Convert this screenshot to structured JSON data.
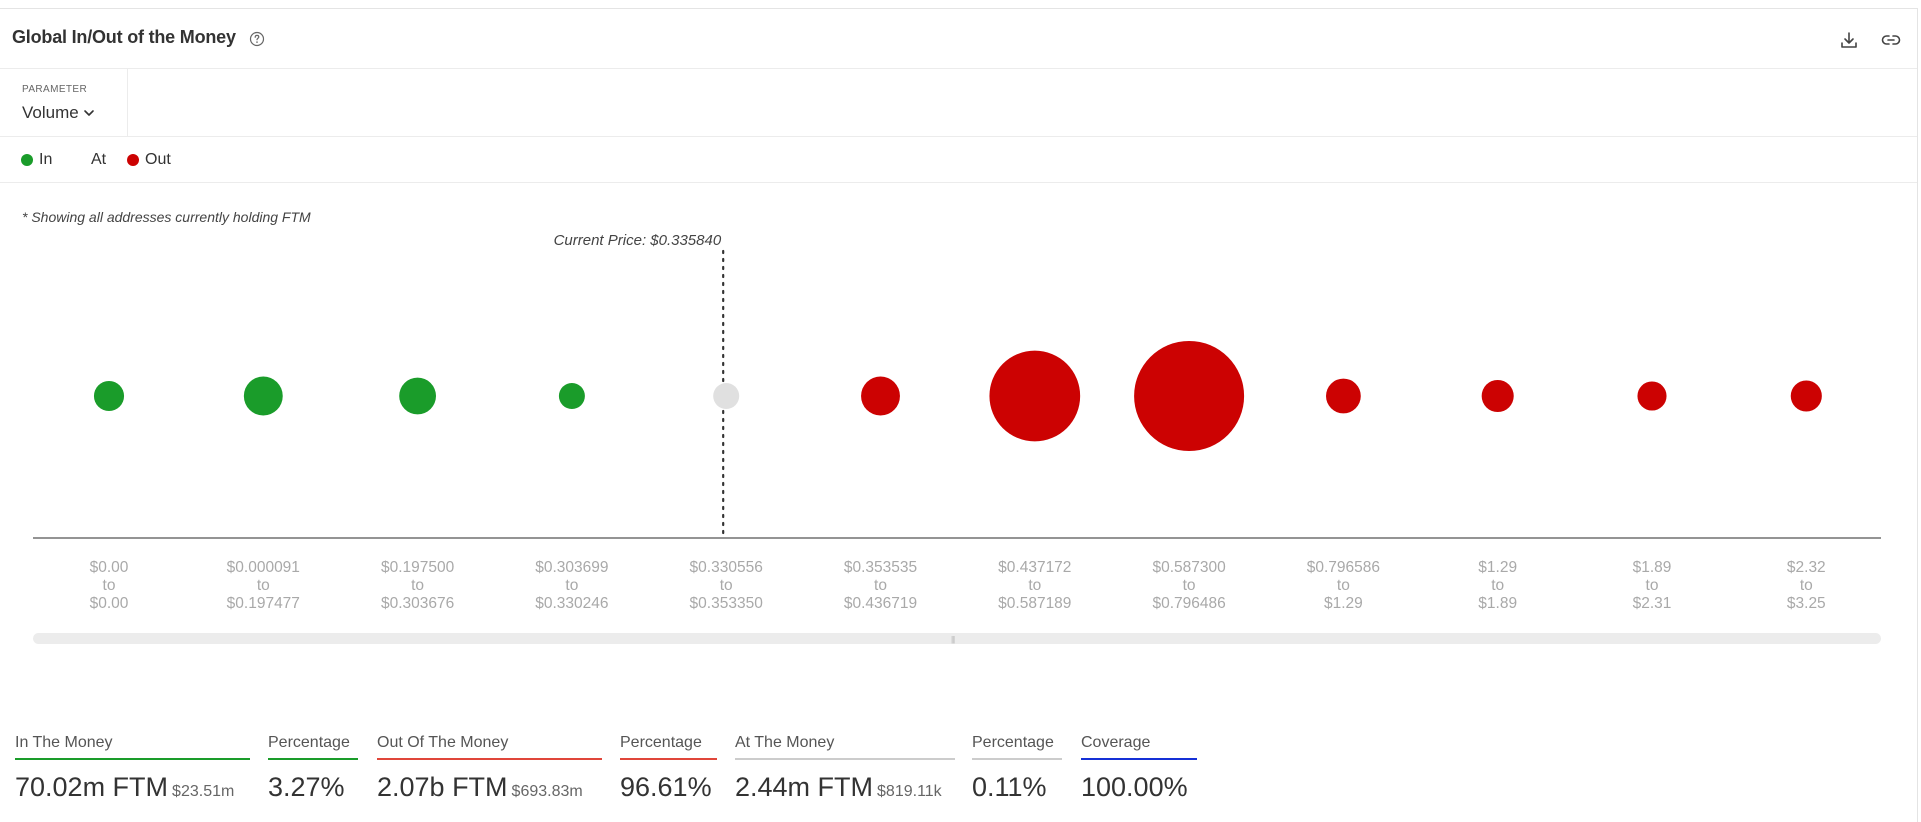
{
  "header": {
    "title": "Global In/Out of the Money"
  },
  "parameter": {
    "label": "PARAMETER",
    "value": "Volume"
  },
  "legend": {
    "items": [
      {
        "label": "In",
        "color": "#1a9c2a"
      },
      {
        "label": "At",
        "color": ""
      },
      {
        "label": "Out",
        "color": "#cc0202"
      }
    ]
  },
  "note": "* Showing all addresses currently holding FTM",
  "chart_data": {
    "type": "scatter",
    "current_price_label": "Current Price: $0.335840",
    "current_price": 0.33584,
    "current_price_bucket_index": 4,
    "buckets": [
      {
        "from": "$0.00",
        "to": "$0.00",
        "status": "in",
        "relative_volume": 0.075
      },
      {
        "from": "$0.000091",
        "to": "$0.197477",
        "status": "in",
        "relative_volume": 0.125
      },
      {
        "from": "$0.197500",
        "to": "$0.303676",
        "status": "in",
        "relative_volume": 0.112
      },
      {
        "from": "$0.303699",
        "to": "$0.330246",
        "status": "in",
        "relative_volume": 0.05
      },
      {
        "from": "$0.330556",
        "to": "$0.353350",
        "status": "at",
        "relative_volume": 0.05
      },
      {
        "from": "$0.353535",
        "to": "$0.436719",
        "status": "out",
        "relative_volume": 0.125
      },
      {
        "from": "$0.437172",
        "to": "$0.587189",
        "status": "out",
        "relative_volume": 0.68
      },
      {
        "from": "$0.587300",
        "to": "$0.796486",
        "status": "out",
        "relative_volume": 1.0
      },
      {
        "from": "$0.796586",
        "to": "$1.29",
        "status": "out",
        "relative_volume": 0.1
      },
      {
        "from": "$1.29",
        "to": "$1.89",
        "status": "out",
        "relative_volume": 0.085
      },
      {
        "from": "$1.89",
        "to": "$2.31",
        "status": "out",
        "relative_volume": 0.07
      },
      {
        "from": "$2.32",
        "to": "$3.25",
        "status": "out",
        "relative_volume": 0.08
      }
    ],
    "range_connector": "to",
    "colors": {
      "in": "#1a9c2a",
      "at": "#e0e0e0",
      "out": "#cc0202"
    }
  },
  "stats": [
    {
      "label": "In The Money",
      "main": "70.02m FTM",
      "sub": "$23.51m",
      "color": "#1a9c2a"
    },
    {
      "label": "Percentage",
      "main": "3.27%",
      "sub": "",
      "color": "#1a9c2a"
    },
    {
      "label": "Out Of The Money",
      "main": "2.07b FTM",
      "sub": "$693.83m",
      "color": "#e0463a"
    },
    {
      "label": "Percentage",
      "main": "96.61%",
      "sub": "",
      "color": "#e0463a"
    },
    {
      "label": "At The Money",
      "main": "2.44m FTM",
      "sub": "$819.11k",
      "color": "#cccccc"
    },
    {
      "label": "Percentage",
      "main": "0.11%",
      "sub": "",
      "color": "#cccccc"
    },
    {
      "label": "Coverage",
      "main": "100.00%",
      "sub": "",
      "color": "#1530d6"
    }
  ]
}
